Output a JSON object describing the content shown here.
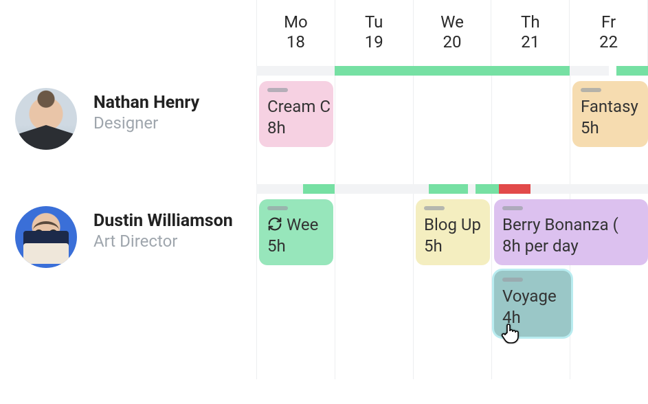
{
  "days": [
    {
      "abbr": "Mo",
      "num": "18"
    },
    {
      "abbr": "Tu",
      "num": "19"
    },
    {
      "abbr": "We",
      "num": "20"
    },
    {
      "abbr": "Th",
      "num": "21"
    },
    {
      "abbr": "Fr",
      "num": "22"
    }
  ],
  "people": [
    {
      "name": "Nathan Henry",
      "role": "Designer"
    },
    {
      "name": "Dustin Williamson",
      "role": "Art Director"
    }
  ],
  "tasks": {
    "nathan_cream": {
      "title": "Cream C",
      "hours": "8h"
    },
    "nathan_fantasy": {
      "title": "Fantasy",
      "hours": "5h"
    },
    "dustin_wee": {
      "title": "Wee",
      "hours": "5h"
    },
    "dustin_blog": {
      "title": "Blog Up",
      "hours": "5h"
    },
    "dustin_berry": {
      "title": "Berry Bonanza (",
      "hours": "8h per day"
    },
    "dustin_voyage": {
      "title": "Voyage",
      "hours": "4h"
    }
  }
}
